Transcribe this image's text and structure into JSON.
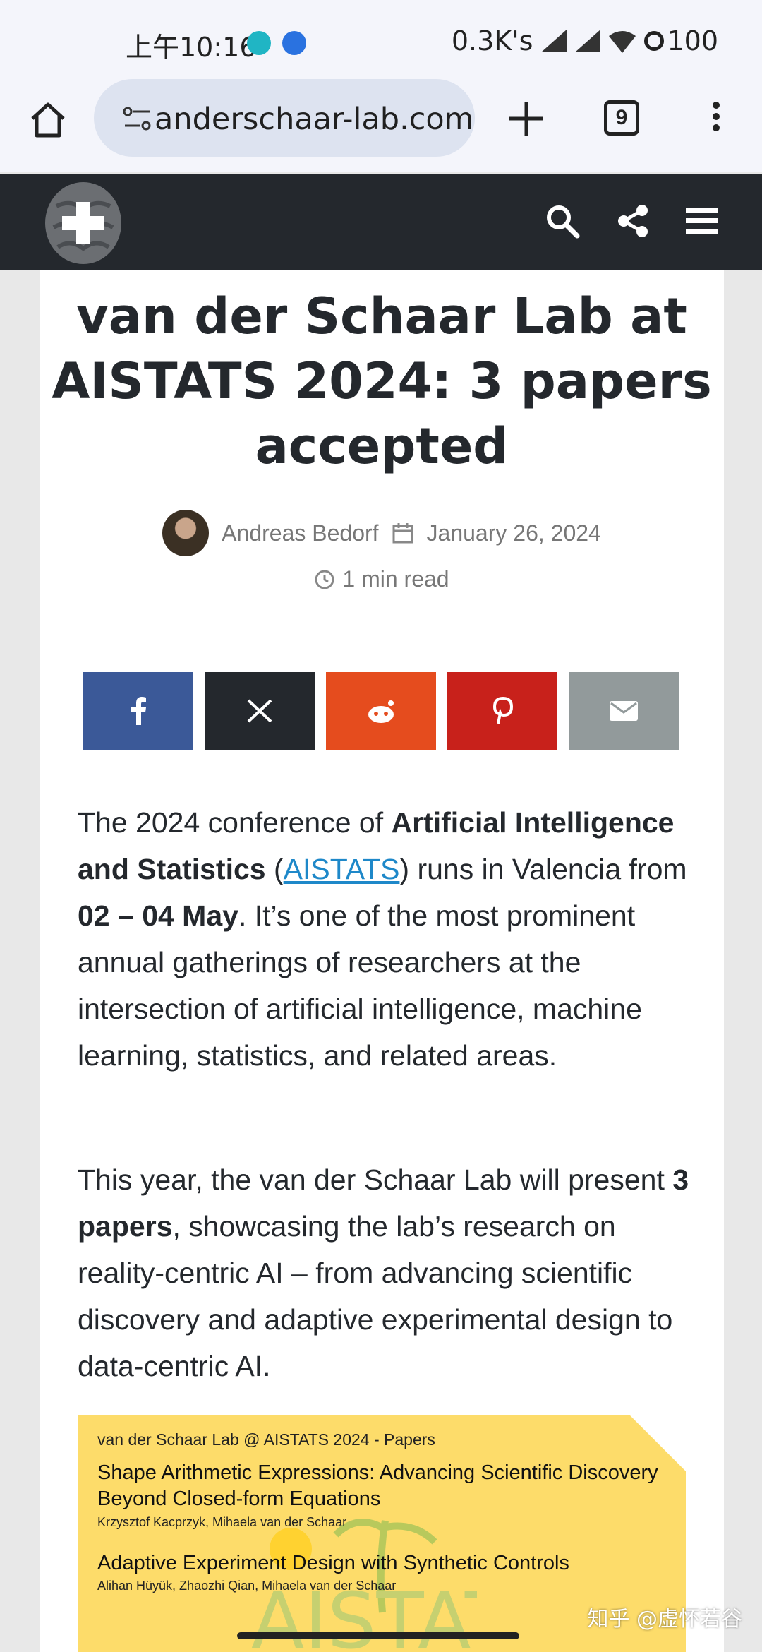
{
  "status_bar": {
    "time": "上午10:16",
    "right": "0.3K's",
    "battery": "100"
  },
  "browser": {
    "url": "anderschaar-lab.com",
    "tab_count": "9"
  },
  "article": {
    "title": "van der Schaar Lab at AISTATS 2024: 3 papers accepted",
    "author": "Andreas Bedorf",
    "date": "January 26, 2024",
    "read_time": "1 min read",
    "share_buttons": [
      {
        "name": "facebook",
        "color": "#3b5998"
      },
      {
        "name": "x",
        "color": "#24282d"
      },
      {
        "name": "reddit",
        "color": "#e54c1e"
      },
      {
        "name": "pinterest",
        "color": "#c8211b"
      },
      {
        "name": "email",
        "color": "#929a9b"
      }
    ],
    "p1": {
      "t1": "The 2024 conference of ",
      "b1": "Artificial Intelligence and Statistics",
      "t2": " (",
      "link": "AISTATS",
      "t3": ") runs in Valencia from ",
      "b2": "02 – 04 May",
      "t4": ". It’s one of the most prominent annual gatherings of researchers at the intersection of artificial intelligence, machine learning, statistics, and related areas."
    },
    "p2": {
      "t1": "This year, the van der Schaar Lab will present ",
      "b1": "3 papers",
      "t2": ", showcasing the lab’s research on reality-centric AI – from advancing scientific discovery and adaptive experimental design to data-centric AI."
    },
    "banner": {
      "header": "van der Schaar Lab @ AISTATS 2024 - Papers",
      "paper1_title": "Shape Arithmetic Expressions: Advancing Scientific Discovery Beyond Closed-form Equations",
      "paper1_authors": "Krzysztof Kacprzyk, Mihaela van der Schaar",
      "paper2_title": "Adaptive Experiment Design with Synthetic Controls",
      "paper2_authors": "Alihan Hüyük, Zhaozhi Qian, Mihaela van der Schaar",
      "watermark": "AISTATS"
    }
  },
  "watermark": "知乎 @虚怀若谷"
}
